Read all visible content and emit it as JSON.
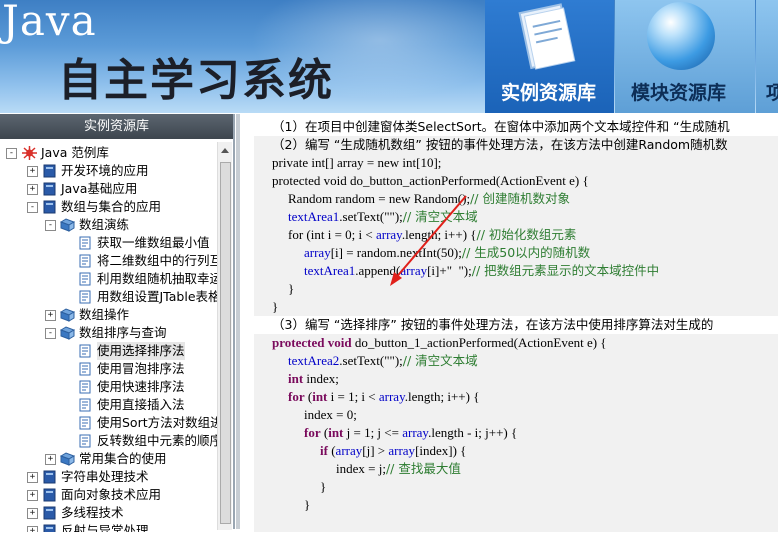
{
  "banner": {
    "brand": "Java",
    "title": "自主学习系统",
    "tabs": [
      {
        "label": "实例资源库",
        "icon": "book-icon",
        "active": true
      },
      {
        "label": "模块资源库",
        "icon": "globe-icon",
        "active": false
      },
      {
        "label": "项",
        "icon": "",
        "active": false
      }
    ]
  },
  "sidebar": {
    "header": "实例资源库",
    "root": "Java 范例库",
    "items": [
      {
        "label": "开发环境的应用"
      },
      {
        "label": "Java基础应用"
      },
      {
        "label": "数组与集合的应用"
      },
      {
        "label": "数组演练"
      },
      {
        "label": "获取一维数组最小值"
      },
      {
        "label": "将二维数组中的行列互"
      },
      {
        "label": "利用数组随机抽取幸运"
      },
      {
        "label": "用数组设置JTable表格"
      },
      {
        "label": "数组操作"
      },
      {
        "label": "数组排序与查询"
      },
      {
        "label": "使用选择排序法"
      },
      {
        "label": "使用冒泡排序法"
      },
      {
        "label": "使用快速排序法"
      },
      {
        "label": "使用直接插入法"
      },
      {
        "label": "使用Sort方法对数组进"
      },
      {
        "label": "反转数组中元素的顺序"
      },
      {
        "label": "常用集合的使用"
      },
      {
        "label": "字符串处理技术"
      },
      {
        "label": "面向对象技术应用"
      },
      {
        "label": "多线程技术"
      },
      {
        "label": "反射与异常处理"
      }
    ]
  },
  "content": {
    "lines": [
      {
        "segs": [
          {
            "t": "（1）在项目中创建窗体类SelectSort。在窗体中添加两个文本域控件和 “生成随机",
            "c": "cn"
          }
        ]
      },
      {
        "segs": [
          {
            "t": "（2）编写 “生成随机数组” 按钮的事件处理方法，在该方法中创建Random随机数",
            "c": "cn"
          }
        ]
      },
      {
        "segs": [
          {
            "t": "private int[] array = new int[10];",
            "c": ""
          }
        ]
      },
      {
        "segs": [
          {
            "t": "protected void do_button_actionPerformed(ActionEvent e) {",
            "c": ""
          }
        ]
      },
      {
        "segs": [
          {
            "t": "Random random = new Random();",
            "c": ""
          },
          {
            "t": "// 创建随机数对象",
            "c": "cm"
          }
        ]
      },
      {
        "segs": [
          {
            "t": "textArea1",
            "c": "fld"
          },
          {
            "t": ".setText(\"\");",
            "c": ""
          },
          {
            "t": "// 清空文本域",
            "c": "cm"
          }
        ]
      },
      {
        "segs": [
          {
            "t": "for (int i = 0; i < ",
            "c": ""
          },
          {
            "t": "array",
            "c": "fld"
          },
          {
            "t": ".length; i++) {",
            "c": ""
          },
          {
            "t": "// 初始化数组元素",
            "c": "cm"
          }
        ]
      },
      {
        "segs": [
          {
            "t": "array",
            "c": "fld"
          },
          {
            "t": "[i] = random.nextInt(50);",
            "c": ""
          },
          {
            "t": "// 生成50以内的随机数",
            "c": "cm"
          }
        ]
      },
      {
        "segs": [
          {
            "t": "textArea1",
            "c": "fld"
          },
          {
            "t": ".append(",
            "c": ""
          },
          {
            "t": "array",
            "c": "fld"
          },
          {
            "t": "[i]+\"  \");",
            "c": ""
          },
          {
            "t": "// 把数组元素显示的文本域控件中",
            "c": "cm"
          }
        ]
      },
      {
        "segs": [
          {
            "t": "}",
            "c": ""
          }
        ]
      },
      {
        "segs": [
          {
            "t": "}",
            "c": ""
          }
        ]
      },
      {
        "segs": [
          {
            "t": "（3）编写 “选择排序” 按钮的事件处理方法，在该方法中使用排序算法对生成的",
            "c": "cn"
          }
        ]
      },
      {
        "segs": [
          {
            "t": "protected void",
            "c": "kw"
          },
          {
            "t": " do_button_1_actionPerformed(ActionEvent e) {",
            "c": ""
          }
        ]
      },
      {
        "segs": [
          {
            "t": "textArea2",
            "c": "fld"
          },
          {
            "t": ".setText(\"\");",
            "c": ""
          },
          {
            "t": "// 清空文本域",
            "c": "cm"
          }
        ]
      },
      {
        "segs": [
          {
            "t": "int",
            "c": "kw"
          },
          {
            "t": " index;",
            "c": ""
          }
        ]
      },
      {
        "segs": [
          {
            "t": "for",
            "c": "kw"
          },
          {
            "t": " (",
            "c": ""
          },
          {
            "t": "int",
            "c": "kw"
          },
          {
            "t": " i = 1; i < ",
            "c": ""
          },
          {
            "t": "array",
            "c": "fld"
          },
          {
            "t": ".length; i++) {",
            "c": ""
          }
        ]
      },
      {
        "segs": [
          {
            "t": "index = 0;",
            "c": ""
          }
        ]
      },
      {
        "segs": [
          {
            "t": "for",
            "c": "kw"
          },
          {
            "t": " (",
            "c": ""
          },
          {
            "t": "int",
            "c": "kw"
          },
          {
            "t": " j = 1; j <= ",
            "c": ""
          },
          {
            "t": "array",
            "c": "fld"
          },
          {
            "t": ".length - i; j++) {",
            "c": ""
          }
        ]
      },
      {
        "segs": [
          {
            "t": "if",
            "c": "kw"
          },
          {
            "t": " (",
            "c": ""
          },
          {
            "t": "array",
            "c": "fld"
          },
          {
            "t": "[j] > ",
            "c": ""
          },
          {
            "t": "array",
            "c": "fld"
          },
          {
            "t": "[index]) {",
            "c": ""
          }
        ]
      },
      {
        "segs": [
          {
            "t": "index = j;",
            "c": ""
          },
          {
            "t": "// 查找最大值",
            "c": "cm"
          }
        ]
      },
      {
        "segs": [
          {
            "t": "}",
            "c": ""
          }
        ]
      },
      {
        "segs": [
          {
            "t": "}",
            "c": ""
          }
        ]
      }
    ]
  }
}
